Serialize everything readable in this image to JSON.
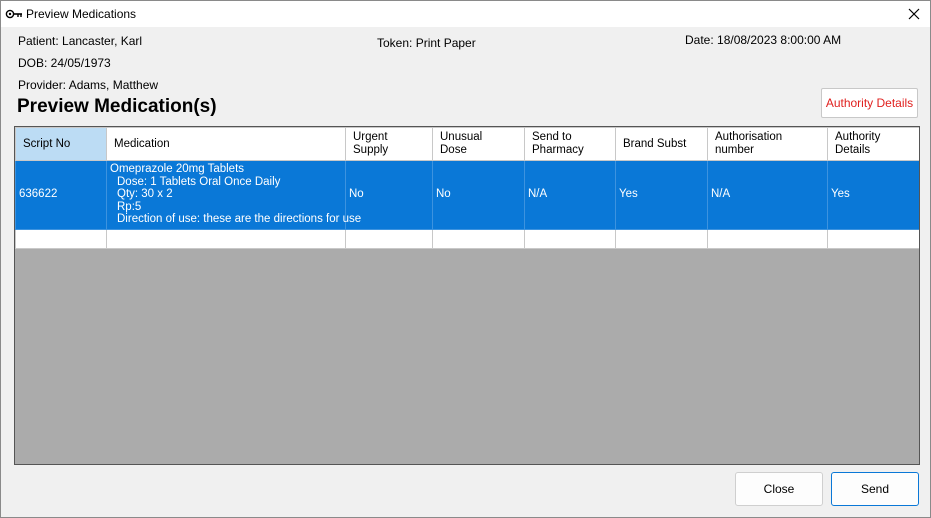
{
  "window": {
    "title": "Preview Medications"
  },
  "info": {
    "patient": "Patient: Lancaster, Karl",
    "dob": "DOB: 24/05/1973",
    "provider": "Provider: Adams, Matthew",
    "token": "Token: Print Paper",
    "date": "Date: 18/08/2023 8:00:00 AM"
  },
  "heading": "Preview Medication(s)",
  "authority_button": "Authority Details",
  "grid": {
    "columns": [
      [
        "Script No"
      ],
      [
        "Medication"
      ],
      [
        "Urgent",
        "Supply"
      ],
      [
        "Unusual",
        "Dose"
      ],
      [
        "Send to",
        "Pharmacy"
      ],
      [
        "Brand Subst"
      ],
      [
        "Authorisation",
        "number"
      ],
      [
        "Authority",
        "Details"
      ]
    ],
    "row": {
      "script_no": "636622",
      "medication": [
        "Omeprazole 20mg Tablets",
        "  Dose: 1 Tablets Oral Once Daily",
        "  Qty: 30 x 2",
        "  Rp:5",
        "  Direction of use: these are the directions for use"
      ],
      "urgent_supply": "No",
      "unusual_dose": "No",
      "send_to_pharmacy": "N/A",
      "brand_subst": "Yes",
      "authorisation_number": "N/A",
      "authority_details": "Yes"
    }
  },
  "buttons": {
    "close": "Close",
    "send": "Send"
  },
  "colors": {
    "selection": "#0a78d7",
    "header_selected": "#bcdcf4",
    "authority_text": "#e0201e",
    "grid_empty": "#ababab"
  }
}
